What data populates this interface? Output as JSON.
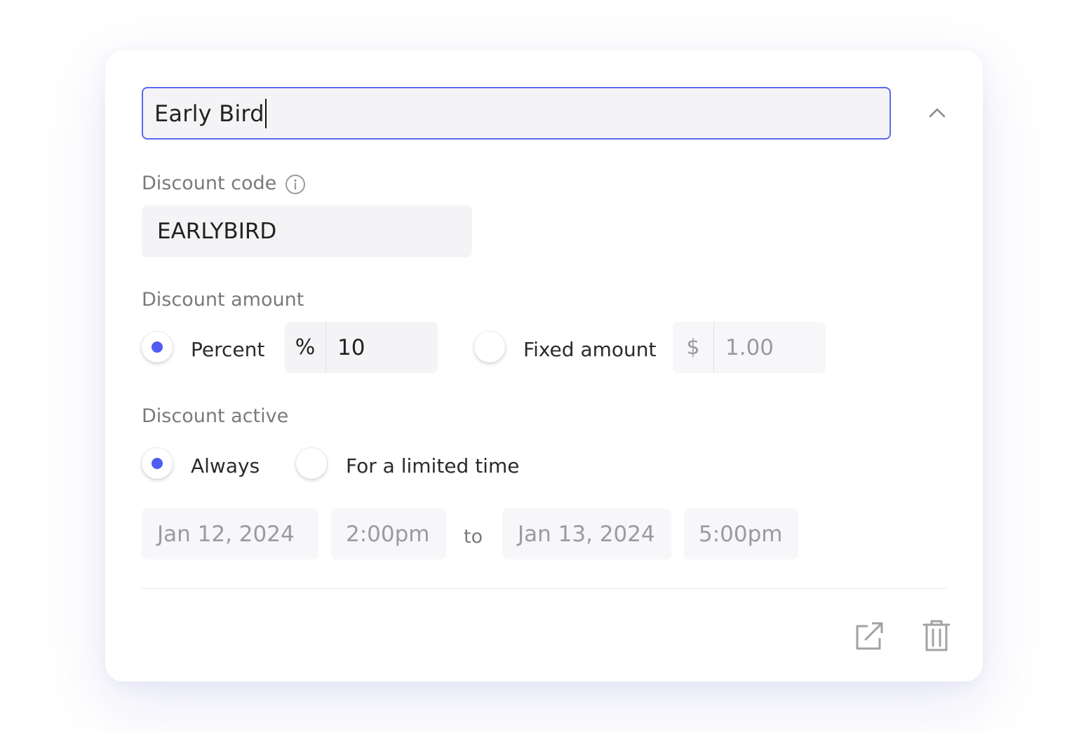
{
  "discount": {
    "name": "Early Bird",
    "code_label": "Discount code",
    "code_value": "EARLYBIRD",
    "amount_label": "Discount amount",
    "percent": {
      "label": "Percent",
      "selected": true,
      "prefix": "%",
      "value": "10"
    },
    "fixed": {
      "label": "Fixed amount",
      "selected": false,
      "prefix": "$",
      "value": "1.00"
    },
    "active_label": "Discount active",
    "always": {
      "label": "Always",
      "selected": true
    },
    "limited": {
      "label": "For a limited time",
      "selected": false
    },
    "start_date": "Jan 12, 2024",
    "start_time": "2:00pm",
    "to_label": "to",
    "end_date": "Jan 13, 2024",
    "end_time": "5:00pm"
  },
  "icons": {
    "collapse": "chevron-up-icon",
    "info": "info-icon",
    "open": "external-link-icon",
    "delete": "trash-icon"
  },
  "colors": {
    "accent": "#4f5cf2",
    "input_bg": "#f4f4f6",
    "label": "#7a7a7e",
    "muted": "#9a9aa0"
  }
}
